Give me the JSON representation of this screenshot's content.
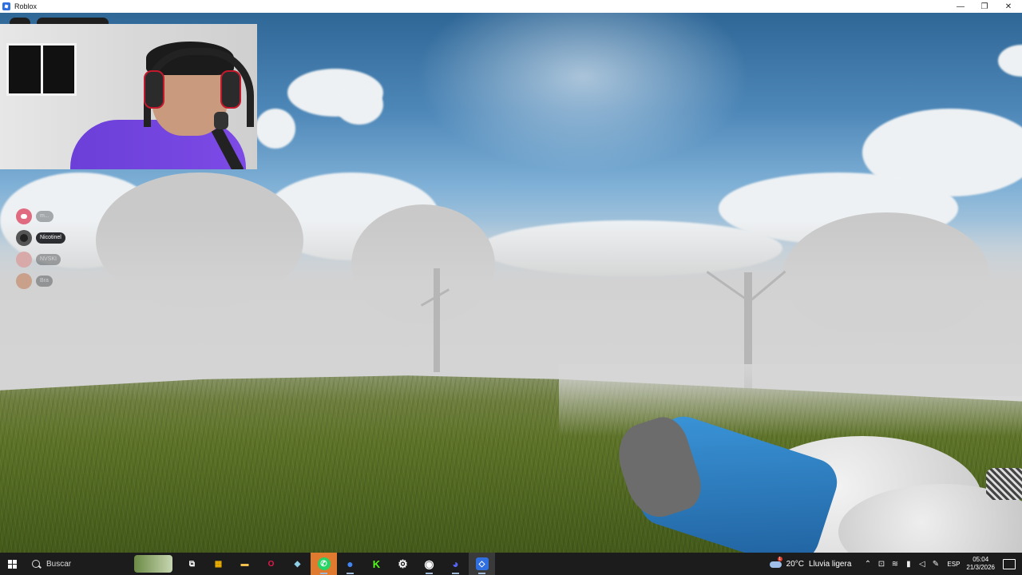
{
  "window": {
    "title": "Roblox",
    "controls": {
      "minimize": "—",
      "restore": "❐",
      "close": "✕"
    }
  },
  "voice_overlay": {
    "members": [
      {
        "name": "m...",
        "avatar": "discord-icon",
        "speaking": false
      },
      {
        "name": "Nicotinel",
        "avatar": "user-avatar",
        "speaking": true
      },
      {
        "name": "NVSKI",
        "avatar": "user-avatar",
        "speaking": false
      },
      {
        "name": "Bra",
        "avatar": "user-avatar",
        "speaking": false
      }
    ]
  },
  "taskbar": {
    "search_label": "Buscar",
    "pinned": [
      {
        "name": "task-view-icon",
        "glyph": "⧉",
        "color": "#ffffff"
      },
      {
        "name": "microsoft-store-icon",
        "glyph": "▦",
        "color": "#f4b400"
      },
      {
        "name": "file-explorer-icon",
        "glyph": "▬",
        "color": "#f2c14e"
      },
      {
        "name": "opera-gx-icon",
        "glyph": "O",
        "color": "#e5194b"
      },
      {
        "name": "notepad-icon",
        "glyph": "◆",
        "color": "#8fd0e8"
      },
      {
        "name": "whatsapp-icon",
        "glyph": "✆",
        "color": "#25d366"
      },
      {
        "name": "chrome-icon",
        "glyph": "●",
        "color": "#4285f4"
      },
      {
        "name": "kick-icon",
        "glyph": "K",
        "color": "#53fc18"
      },
      {
        "name": "settings-icon",
        "glyph": "⚙",
        "color": "#ffffff"
      },
      {
        "name": "obs-icon",
        "glyph": "◉",
        "color": "#e0e0e0"
      },
      {
        "name": "discord-icon",
        "glyph": "◕",
        "color": "#5865f2"
      },
      {
        "name": "roblox-icon",
        "glyph": "◇",
        "color": "#2f6fe0"
      }
    ],
    "tray": {
      "temperature": "20°C",
      "condition": "Lluvia ligera",
      "weather_badge": "1",
      "language": "ESP",
      "time": "05:04",
      "date": "21/3/2026"
    }
  }
}
